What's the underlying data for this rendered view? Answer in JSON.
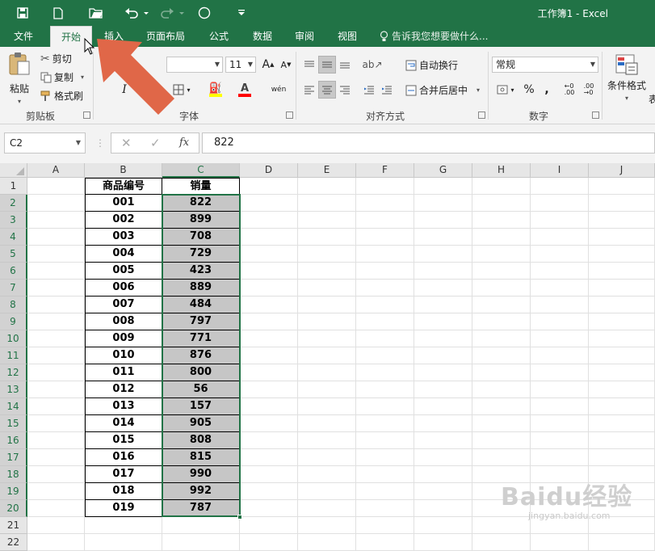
{
  "window": {
    "title": "工作簿1 - Excel"
  },
  "quick_access": {
    "icons": [
      "save-icon",
      "new-file-icon",
      "open-folder-icon",
      "undo-icon",
      "redo-icon",
      "touch-mode-icon",
      "customize-icon"
    ]
  },
  "ribbon_tabs": [
    {
      "label": "文件"
    },
    {
      "label": "开始",
      "active": true
    },
    {
      "label": "插入"
    },
    {
      "label": "页面布局"
    },
    {
      "label": "公式"
    },
    {
      "label": "数据"
    },
    {
      "label": "审阅"
    },
    {
      "label": "视图"
    }
  ],
  "tell_me": {
    "placeholder": "告诉我您想要做什么..."
  },
  "clipboard": {
    "paste_label": "粘贴",
    "cut_label": "剪切",
    "copy_label": "复制",
    "format_painter_label": "格式刷",
    "group_label": "剪贴板"
  },
  "font": {
    "size": "11",
    "grow_label": "A",
    "shrink_label": "A",
    "italic_label": "I",
    "phonetic_label": "wén",
    "group_label": "字体",
    "highlight_color": "#ffff00",
    "font_color": "#ff0000"
  },
  "alignment": {
    "wrap_text_label": "自动换行",
    "merge_center_label": "合并后居中",
    "group_label": "对齐方式"
  },
  "number": {
    "format": "常规",
    "percent_label": "%",
    "comma_label": ",",
    "group_label": "数字"
  },
  "styles": {
    "conditional_format_label": "条件格式",
    "truncated_label": "表"
  },
  "formula_bar": {
    "name_box": "C2",
    "fx_label": "fx",
    "value": "822"
  },
  "sheet": {
    "columns": [
      "A",
      "B",
      "C",
      "D",
      "E",
      "F",
      "G",
      "H",
      "I",
      "J"
    ],
    "rows": [
      "1",
      "2",
      "3",
      "4",
      "5",
      "6",
      "7",
      "8",
      "9",
      "10",
      "11",
      "12",
      "13",
      "14",
      "15",
      "16",
      "17",
      "18",
      "19",
      "20",
      "21",
      "22"
    ],
    "header": {
      "code": "商品编号",
      "sales": "销量"
    },
    "records": [
      {
        "code": "001",
        "sales": "822"
      },
      {
        "code": "002",
        "sales": "899"
      },
      {
        "code": "003",
        "sales": "708"
      },
      {
        "code": "004",
        "sales": "729"
      },
      {
        "code": "005",
        "sales": "423"
      },
      {
        "code": "006",
        "sales": "889"
      },
      {
        "code": "007",
        "sales": "484"
      },
      {
        "code": "008",
        "sales": "797"
      },
      {
        "code": "009",
        "sales": "771"
      },
      {
        "code": "010",
        "sales": "876"
      },
      {
        "code": "011",
        "sales": "800"
      },
      {
        "code": "012",
        "sales": "56"
      },
      {
        "code": "013",
        "sales": "157"
      },
      {
        "code": "014",
        "sales": "905"
      },
      {
        "code": "015",
        "sales": "808"
      },
      {
        "code": "016",
        "sales": "815"
      },
      {
        "code": "017",
        "sales": "990"
      },
      {
        "code": "018",
        "sales": "992"
      },
      {
        "code": "019",
        "sales": "787"
      }
    ],
    "selection": "C2:C20"
  },
  "colors": {
    "accent": "#217346",
    "selection_fill": "#c6c6c6",
    "arrow": "#e06748"
  },
  "watermark": {
    "brand": "Baidu经验",
    "url": "jingyan.baidu.com"
  }
}
